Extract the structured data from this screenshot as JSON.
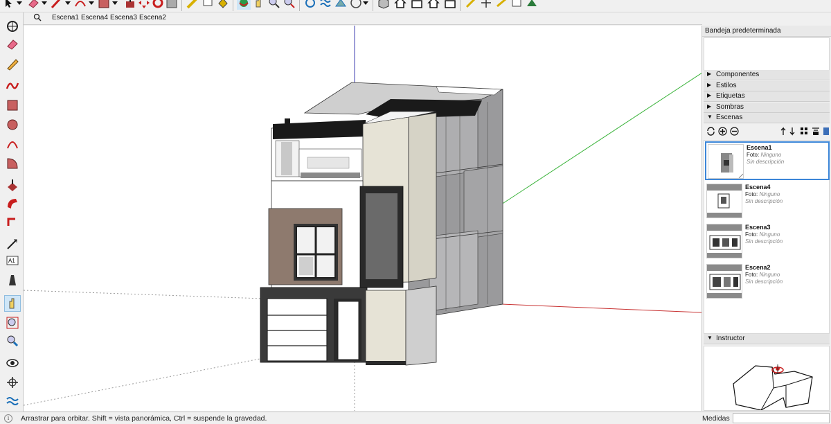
{
  "toolbar": {
    "icons": [
      "select-arrow-icon",
      "dropdown-icon",
      "eraser-icon",
      "dropdown-icon",
      "pencil-line-icon",
      "dropdown-icon",
      "arc-icon",
      "dropdown-icon",
      "rectangle-icon",
      "dropdown-icon",
      "push-pull-icon",
      "move-icon",
      "rotate-icon",
      "offset-icon",
      "tape-measure-icon",
      "text-label-icon",
      "paint-bucket-icon",
      "orbit-icon",
      "pan-icon",
      "zoom-icon",
      "zoom-extents-icon",
      "warehouse-icon",
      "extension-icon",
      "sandbox-icon",
      "styles-icon",
      "component-icon",
      "house-icon",
      "house-icon",
      "house-icon",
      "house-icon",
      "section-icon",
      "axes-icon",
      "dimension-icon",
      "3d-text-icon",
      "layers-icon"
    ]
  },
  "scene_tabs": {
    "tabs": [
      "Escena1",
      "Escena4",
      "Escena3",
      "Escena2"
    ]
  },
  "tray": {
    "title": "Bandeja predeterminada",
    "panels": [
      {
        "label": "Componentes",
        "expanded": false
      },
      {
        "label": "Estilos",
        "expanded": false
      },
      {
        "label": "Etiquetas",
        "expanded": false
      },
      {
        "label": "Sombras",
        "expanded": false
      },
      {
        "label": "Escenas",
        "expanded": true
      }
    ],
    "scenes": [
      {
        "name": "Escena1",
        "photo_label": "Foto:",
        "photo_value": "Ninguno",
        "desc": "Sin descripción",
        "selected": true
      },
      {
        "name": "Escena4",
        "photo_label": "Foto:",
        "photo_value": "Ninguno",
        "desc": "Sin descripción",
        "selected": false
      },
      {
        "name": "Escena3",
        "photo_label": "Foto:",
        "photo_value": "Ninguno",
        "desc": "Sin descripción",
        "selected": false
      },
      {
        "name": "Escena2",
        "photo_label": "Foto:",
        "photo_value": "Ninguno",
        "desc": "Sin descripción",
        "selected": false
      }
    ],
    "instructor_label": "Instructor"
  },
  "status": {
    "hint": "Arrastrar para orbitar. Shift = vista panorámica, Ctrl = suspende la gravedad.",
    "measures_label": "Medidas",
    "measures_value": "",
    "info_glyph": "i"
  },
  "colors": {
    "axis_blue": "#3c3cb0",
    "axis_green": "#3cb43c",
    "axis_red": "#c83232",
    "selection": "#3c86d8"
  }
}
